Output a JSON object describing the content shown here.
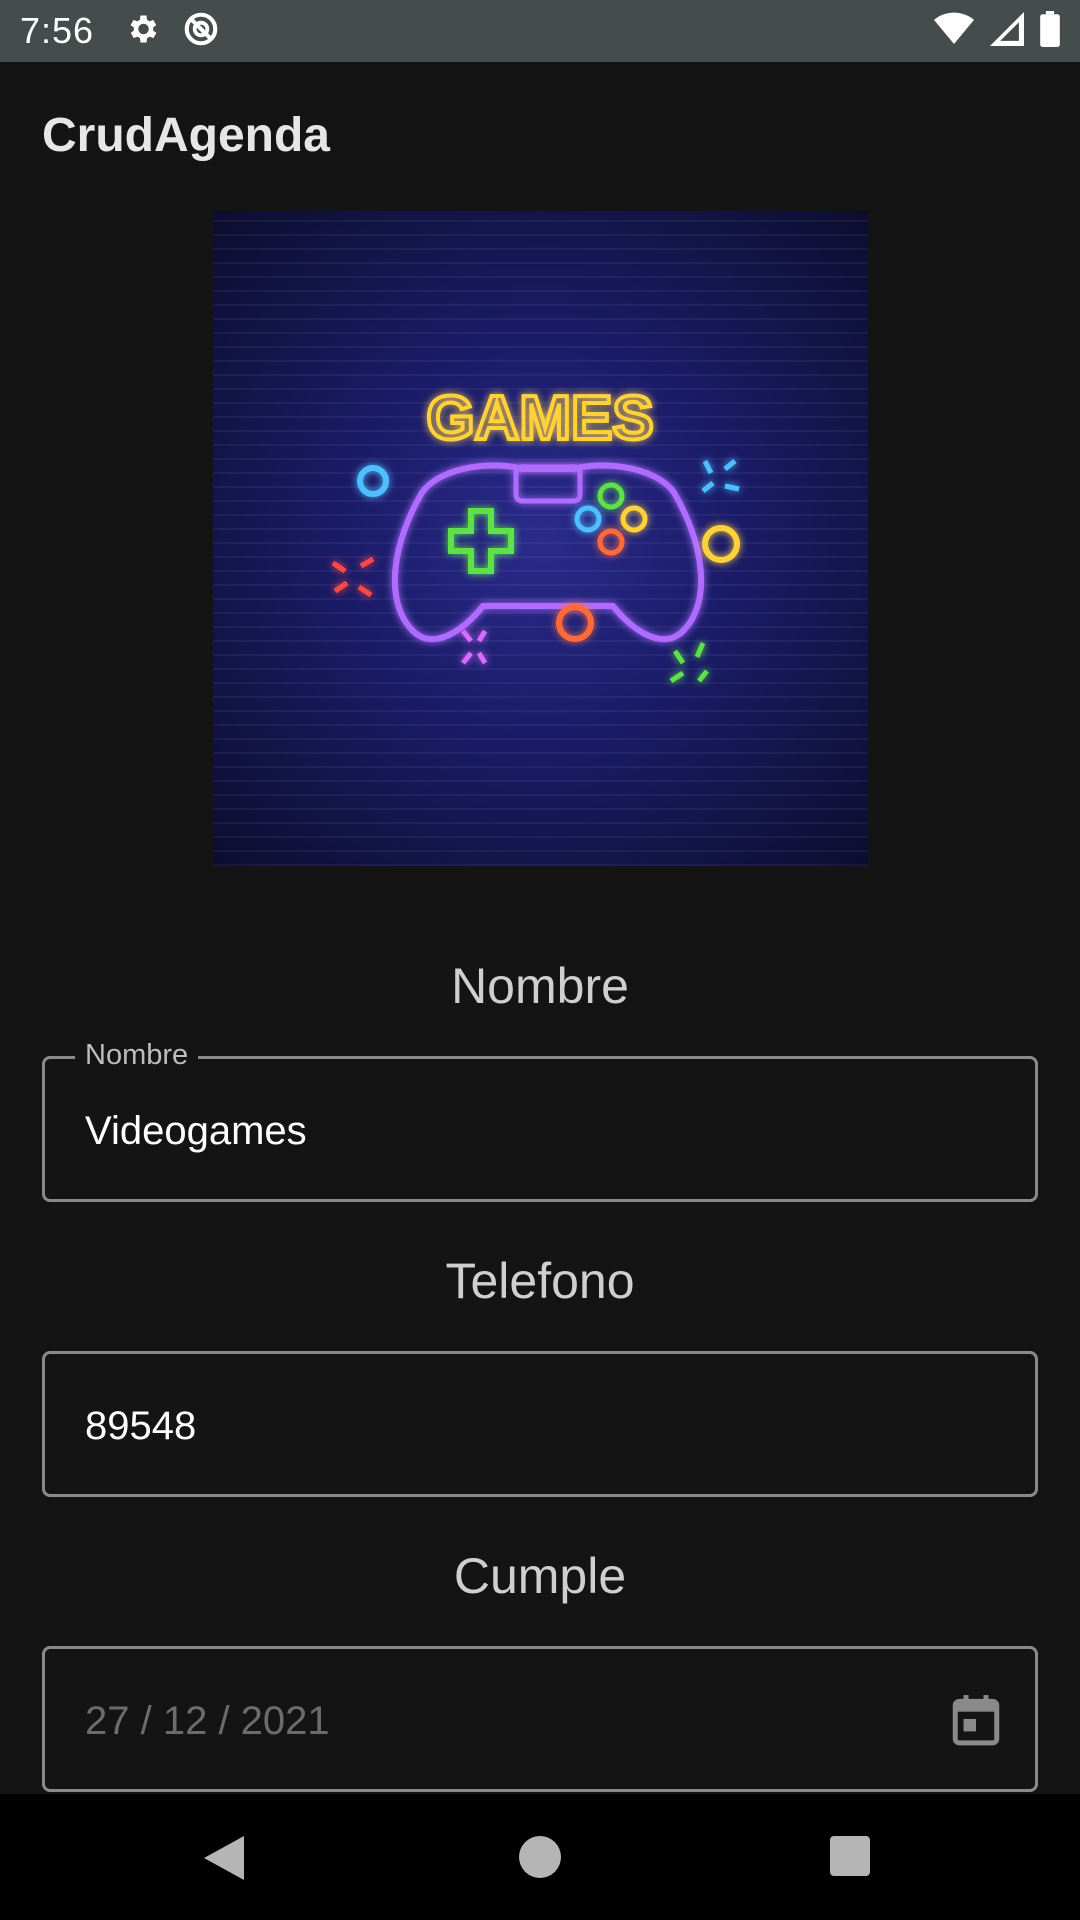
{
  "status_bar": {
    "time": "7:56",
    "icons": [
      "gear-icon",
      "no-data-saver-icon",
      "wifi-icon",
      "cell-signal-icon",
      "battery-icon"
    ]
  },
  "app": {
    "title": "CrudAgenda"
  },
  "hero_image": {
    "text": "GAMES",
    "description_icon": "game-controller-neon-image"
  },
  "form": {
    "nombre": {
      "section_label": "Nombre",
      "floating_label": "Nombre",
      "value": "Videogames"
    },
    "telefono": {
      "section_label": "Telefono",
      "value": "89548"
    },
    "cumple": {
      "section_label": "Cumple",
      "placeholder": "27 / 12 / 2021",
      "icon": "calendar-icon"
    }
  },
  "nav_bar": {
    "buttons": [
      "back-icon",
      "home-icon",
      "recents-icon"
    ]
  },
  "colors": {
    "background": "#141414",
    "status_bar": "#454c4c",
    "field_border": "#8a8a8a",
    "nav_bar": "#000000"
  }
}
